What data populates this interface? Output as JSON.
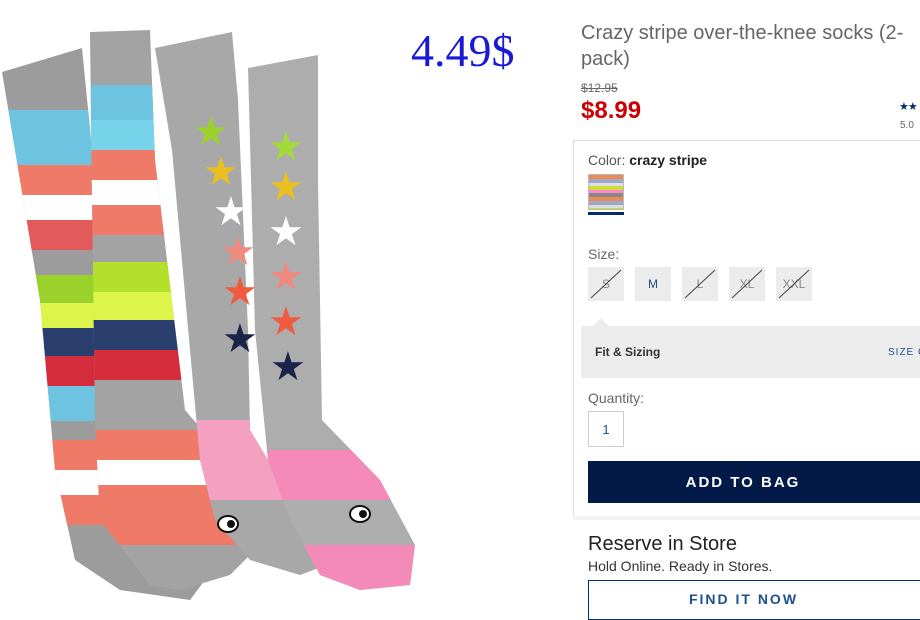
{
  "overlay": {
    "price": "4.49$"
  },
  "product": {
    "title": "Crazy stripe over-the-knee socks (2-pack)",
    "original_price": "$12.95",
    "sale_price": "$8.99",
    "stars": "★★",
    "rating": "5.0"
  },
  "color": {
    "label": "Color: ",
    "value": "crazy stripe"
  },
  "size": {
    "label": "Size:",
    "options": [
      {
        "label": "S",
        "available": false
      },
      {
        "label": "M",
        "available": true
      },
      {
        "label": "L",
        "available": false
      },
      {
        "label": "XL",
        "available": false
      },
      {
        "label": "XXL",
        "available": false
      }
    ]
  },
  "fit": {
    "label": "Fit & Sizing",
    "size_chart": "SIZE C"
  },
  "quantity": {
    "label": "Quantity:",
    "value": "1"
  },
  "add_to_bag": "ADD TO BAG",
  "reserve": {
    "title": "Reserve in Store",
    "subtitle": "Hold Online. Ready in Stores.",
    "button": "FIND IT NOW"
  },
  "colors": {
    "accent_navy": "#031a48",
    "sale_red": "#cc0000",
    "overlay_blue": "#1a1ad6"
  }
}
